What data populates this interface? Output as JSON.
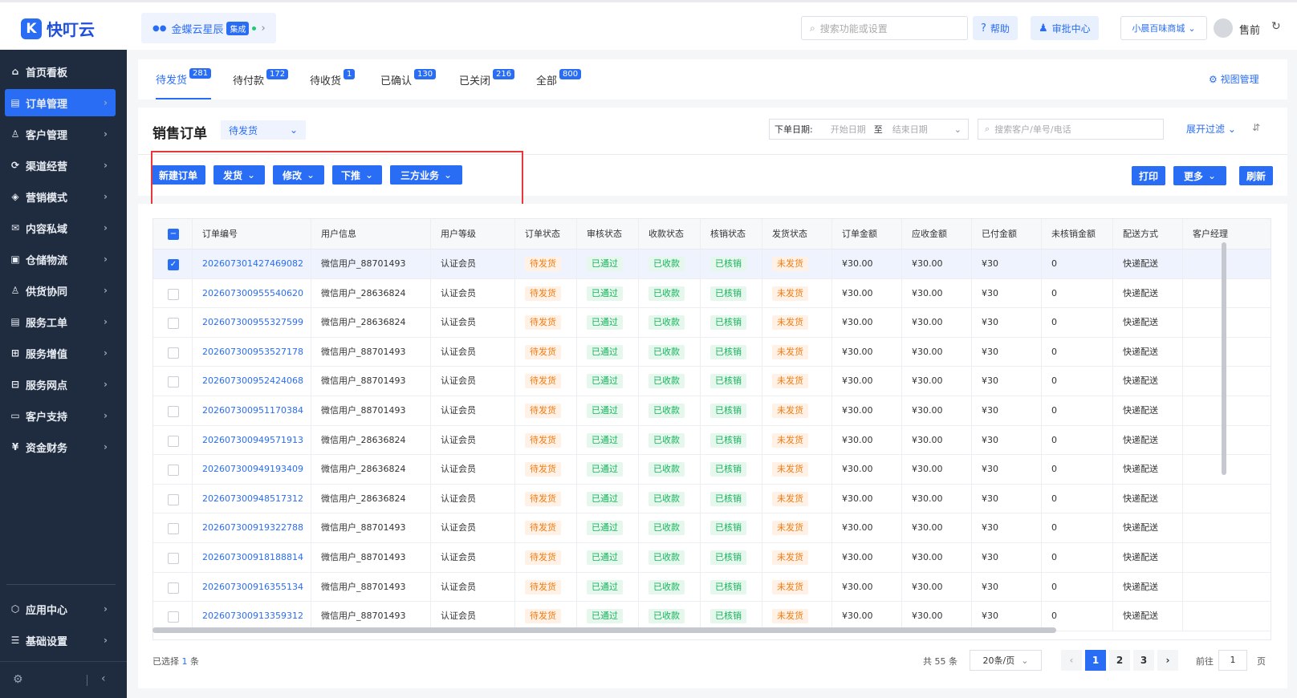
{
  "brand": {
    "name": "快叮云",
    "mark": "K"
  },
  "product": {
    "name": "金蝶云星辰",
    "tag": "集成"
  },
  "header": {
    "search_placeholder": "搜索功能或设置",
    "help": "帮助",
    "approval": "审批中心",
    "store": "小晨百味商城",
    "user": "售前"
  },
  "sidebar": {
    "items": [
      {
        "label": "首页看板",
        "icon": "home-icon",
        "glyph": "⌂"
      },
      {
        "label": "订单管理",
        "icon": "order-icon",
        "glyph": "▤"
      },
      {
        "label": "客户管理",
        "icon": "user-icon",
        "glyph": "♙"
      },
      {
        "label": "渠道经营",
        "icon": "channel-icon",
        "glyph": "⟳"
      },
      {
        "label": "营销模式",
        "icon": "tag-icon",
        "glyph": "◈"
      },
      {
        "label": "内容私域",
        "icon": "mail-icon",
        "glyph": "✉"
      },
      {
        "label": "仓储物流",
        "icon": "warehouse-icon",
        "glyph": "▣"
      },
      {
        "label": "供货协同",
        "icon": "supply-icon",
        "glyph": "♙"
      },
      {
        "label": "服务工单",
        "icon": "ticket-icon",
        "glyph": "▤"
      },
      {
        "label": "服务增值",
        "icon": "gift-icon",
        "glyph": "⊞"
      },
      {
        "label": "服务网点",
        "icon": "store-icon",
        "glyph": "⊟"
      },
      {
        "label": "客户支持",
        "icon": "support-icon",
        "glyph": "▭"
      },
      {
        "label": "资金财务",
        "icon": "finance-icon",
        "glyph": "¥"
      }
    ],
    "bottom_items": [
      {
        "label": "应用中心",
        "icon": "app-icon",
        "glyph": "⬡"
      },
      {
        "label": "基础设置",
        "icon": "settings-icon",
        "glyph": "☰"
      }
    ]
  },
  "tabs": [
    {
      "label": "待发货",
      "count": "281"
    },
    {
      "label": "待付款",
      "count": "172"
    },
    {
      "label": "待收货",
      "count": "1"
    },
    {
      "label": "已确认",
      "count": "130"
    },
    {
      "label": "已关闭",
      "count": "216"
    },
    {
      "label": "全部",
      "count": "800"
    }
  ],
  "view_manage": "视图管理",
  "page": {
    "title": "销售订单",
    "view": "待发货",
    "date_label": "下单日期:",
    "start_placeholder": "开始日期",
    "to": "至",
    "end_placeholder": "结束日期",
    "search_placeholder": "搜索客户/单号/电话",
    "expand_filter": "展开过滤"
  },
  "toolbar": {
    "new_order": "新建订单",
    "ship": "发货",
    "edit": "修改",
    "push_down": "下推",
    "third_party": "三方业务",
    "print": "打印",
    "more": "更多",
    "refresh": "刷新"
  },
  "table": {
    "columns": [
      "订单编号",
      "用户信息",
      "用户等级",
      "订单状态",
      "审核状态",
      "收款状态",
      "核销状态",
      "发货状态",
      "订单金额",
      "应收金额",
      "已付金额",
      "未核销金额",
      "配送方式",
      "客户经理"
    ],
    "rows": [
      {
        "id": "202607301427469082",
        "user": "微信用户_88701493",
        "level": "认证会员",
        "status": "待发货",
        "audit": "已通过",
        "payment": "已收款",
        "writeoff": "已核销",
        "shipping": "未发货",
        "amount": "¥30.00",
        "receivable": "¥30.00",
        "paid": "¥30",
        "unwritten": "0",
        "delivery": "快递配送",
        "checked": true
      },
      {
        "id": "202607300955540620",
        "user": "微信用户_28636824",
        "level": "认证会员",
        "status": "待发货",
        "audit": "已通过",
        "payment": "已收款",
        "writeoff": "已核销",
        "shipping": "未发货",
        "amount": "¥30.00",
        "receivable": "¥30.00",
        "paid": "¥30",
        "unwritten": "0",
        "delivery": "快递配送",
        "checked": false
      },
      {
        "id": "202607300955327599",
        "user": "微信用户_28636824",
        "level": "认证会员",
        "status": "待发货",
        "audit": "已通过",
        "payment": "已收款",
        "writeoff": "已核销",
        "shipping": "未发货",
        "amount": "¥30.00",
        "receivable": "¥30.00",
        "paid": "¥30",
        "unwritten": "0",
        "delivery": "快递配送",
        "checked": false
      },
      {
        "id": "202607300953527178",
        "user": "微信用户_88701493",
        "level": "认证会员",
        "status": "待发货",
        "audit": "已通过",
        "payment": "已收款",
        "writeoff": "已核销",
        "shipping": "未发货",
        "amount": "¥30.00",
        "receivable": "¥30.00",
        "paid": "¥30",
        "unwritten": "0",
        "delivery": "快递配送",
        "checked": false
      },
      {
        "id": "202607300952424068",
        "user": "微信用户_88701493",
        "level": "认证会员",
        "status": "待发货",
        "audit": "已通过",
        "payment": "已收款",
        "writeoff": "已核销",
        "shipping": "未发货",
        "amount": "¥30.00",
        "receivable": "¥30.00",
        "paid": "¥30",
        "unwritten": "0",
        "delivery": "快递配送",
        "checked": false
      },
      {
        "id": "202607300951170384",
        "user": "微信用户_88701493",
        "level": "认证会员",
        "status": "待发货",
        "audit": "已通过",
        "payment": "已收款",
        "writeoff": "已核销",
        "shipping": "未发货",
        "amount": "¥30.00",
        "receivable": "¥30.00",
        "paid": "¥30",
        "unwritten": "0",
        "delivery": "快递配送",
        "checked": false
      },
      {
        "id": "202607300949571913",
        "user": "微信用户_28636824",
        "level": "认证会员",
        "status": "待发货",
        "audit": "已通过",
        "payment": "已收款",
        "writeoff": "已核销",
        "shipping": "未发货",
        "amount": "¥30.00",
        "receivable": "¥30.00",
        "paid": "¥30",
        "unwritten": "0",
        "delivery": "快递配送",
        "checked": false
      },
      {
        "id": "202607300949193409",
        "user": "微信用户_28636824",
        "level": "认证会员",
        "status": "待发货",
        "audit": "已通过",
        "payment": "已收款",
        "writeoff": "已核销",
        "shipping": "未发货",
        "amount": "¥30.00",
        "receivable": "¥30.00",
        "paid": "¥30",
        "unwritten": "0",
        "delivery": "快递配送",
        "checked": false
      },
      {
        "id": "202607300948517312",
        "user": "微信用户_28636824",
        "level": "认证会员",
        "status": "待发货",
        "audit": "已通过",
        "payment": "已收款",
        "writeoff": "已核销",
        "shipping": "未发货",
        "amount": "¥30.00",
        "receivable": "¥30.00",
        "paid": "¥30",
        "unwritten": "0",
        "delivery": "快递配送",
        "checked": false
      },
      {
        "id": "202607300919322788",
        "user": "微信用户_88701493",
        "level": "认证会员",
        "status": "待发货",
        "audit": "已通过",
        "payment": "已收款",
        "writeoff": "已核销",
        "shipping": "未发货",
        "amount": "¥30.00",
        "receivable": "¥30.00",
        "paid": "¥30",
        "unwritten": "0",
        "delivery": "快递配送",
        "checked": false
      },
      {
        "id": "202607300918188814",
        "user": "微信用户_88701493",
        "level": "认证会员",
        "status": "待发货",
        "audit": "已通过",
        "payment": "已收款",
        "writeoff": "已核销",
        "shipping": "未发货",
        "amount": "¥30.00",
        "receivable": "¥30.00",
        "paid": "¥30",
        "unwritten": "0",
        "delivery": "快递配送",
        "checked": false
      },
      {
        "id": "202607300916355134",
        "user": "微信用户_88701493",
        "level": "认证会员",
        "status": "待发货",
        "audit": "已通过",
        "payment": "已收款",
        "writeoff": "已核销",
        "shipping": "未发货",
        "amount": "¥30.00",
        "receivable": "¥30.00",
        "paid": "¥30",
        "unwritten": "0",
        "delivery": "快递配送",
        "checked": false
      },
      {
        "id": "202607300913359312",
        "user": "微信用户_88701493",
        "level": "认证会员",
        "status": "待发货",
        "audit": "已通过",
        "payment": "已收款",
        "writeoff": "已核销",
        "shipping": "未发货",
        "amount": "¥30.00",
        "receivable": "¥30.00",
        "paid": "¥30",
        "unwritten": "0",
        "delivery": "快递配送",
        "checked": false
      }
    ]
  },
  "footer": {
    "selected_prefix": "已选择",
    "selected_count": "1",
    "selected_suffix": "条",
    "total": "共 55 条",
    "page_size": "20条/页",
    "pages": [
      "1",
      "2",
      "3"
    ],
    "current_page": "1",
    "goto_label": "前往",
    "goto_value": "1",
    "goto_suffix": "页"
  },
  "colors": {
    "primary": "#2a6df5",
    "sidebar": "#1f2b3e",
    "warning": "#f07d12",
    "success": "#19b35c",
    "highlight_box": "#e8363b"
  }
}
